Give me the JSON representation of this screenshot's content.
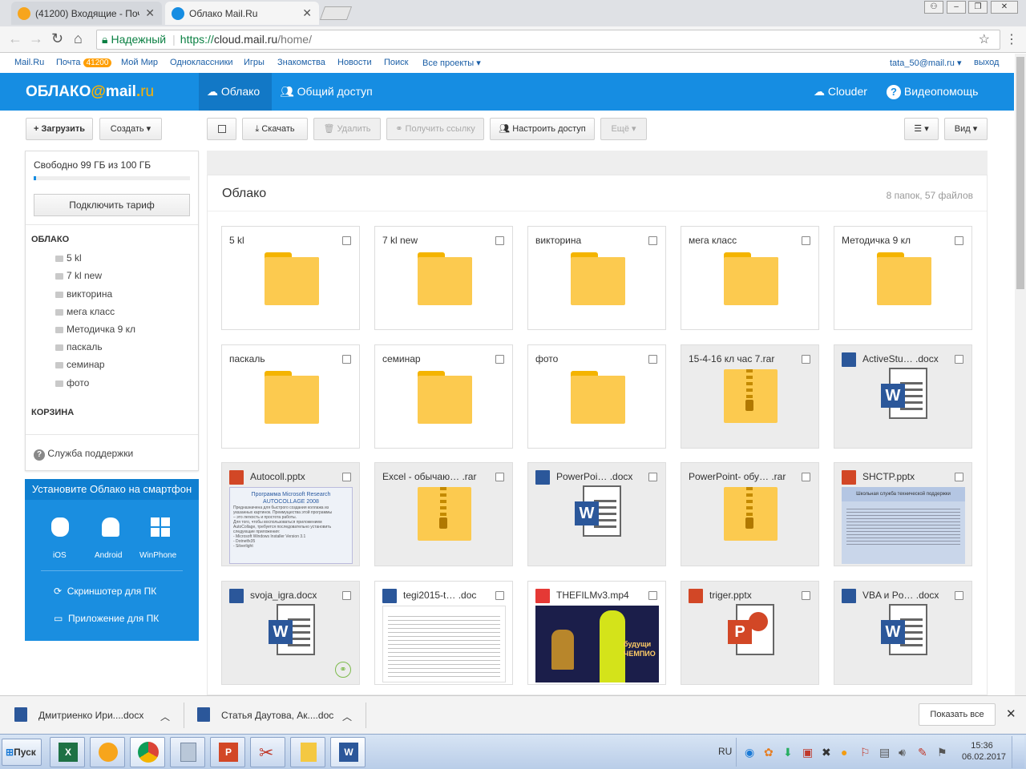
{
  "browser": {
    "tabs": [
      {
        "title": "(41200) Входящие - Почта"
      },
      {
        "title": "Облако Mail.Ru"
      }
    ],
    "url": {
      "secure_label": "Надежный",
      "scheme": "https://",
      "host": "cloud.mail.ru",
      "path": "/home/"
    }
  },
  "portal": {
    "links": [
      "Mail.Ru",
      "Почта",
      "Мой Мир",
      "Одноклассники",
      "Игры",
      "Знакомства",
      "Новости",
      "Поиск",
      "Все проекты"
    ],
    "mail_badge": "41200",
    "user": "tata_50@mail.ru",
    "logout": "выход"
  },
  "header": {
    "logo_main": "ОБЛАКО",
    "logo_at": "@",
    "logo_mail": "mail",
    "logo_dot": ".",
    "logo_ru": "ru",
    "nav_cloud": "Облако",
    "nav_shared": "Общий доступ",
    "clouder": "Clouder",
    "help": "Видеопомощь"
  },
  "toolbar": {
    "upload": "+ Загрузить",
    "create": "Создать",
    "download": "Скачать",
    "delete": "Удалить",
    "get_link": "Получить ссылку",
    "share": "Настроить доступ",
    "more": "Ещё",
    "view": "Вид"
  },
  "sidebar": {
    "quota": "Свободно 99 ГБ из 100 ГБ",
    "quota_used_fraction": 0.01,
    "tariff_button": "Подключить тариф",
    "section_cloud": "ОБЛАКО",
    "folders": [
      "5 kl",
      "7 kl new",
      "викторина",
      "мега класс",
      "Методичка 9 кл",
      "паскаль",
      "семинар",
      "фото"
    ],
    "section_trash": "КОРЗИНА",
    "support": "Служба поддержки"
  },
  "promo": {
    "title": "Установите Облако на смартфон",
    "platforms": [
      "iOS",
      "Android",
      "WinPhone"
    ],
    "screenshoter": "Скриншотер для ПК",
    "app_pc": "Приложение для ПК"
  },
  "main": {
    "title": "Облако",
    "counter": "8 папок, 57 файлов",
    "items": [
      {
        "name": "5 kl",
        "kind": "folder"
      },
      {
        "name": "7 kl new",
        "kind": "folder"
      },
      {
        "name": "викторина",
        "kind": "folder"
      },
      {
        "name": "мега класс",
        "kind": "folder"
      },
      {
        "name": "Методичка 9 кл",
        "kind": "folder"
      },
      {
        "name": "паскаль",
        "kind": "folder"
      },
      {
        "name": "семинар",
        "kind": "folder"
      },
      {
        "name": "фото",
        "kind": "folder"
      },
      {
        "name": "15-4-16 кл час 7.rar",
        "kind": "rar"
      },
      {
        "name": "ActiveStu… .docx",
        "kind": "docx"
      },
      {
        "name": "Autocoll.pptx",
        "kind": "pptx-preview"
      },
      {
        "name": "Excel - обычаю… .rar",
        "kind": "rar"
      },
      {
        "name": "PowerPoi… .docx",
        "kind": "docx"
      },
      {
        "name": "PowerPoint- обу… .rar",
        "kind": "rar"
      },
      {
        "name": "SHCTP.pptx",
        "kind": "pptx-preview2"
      },
      {
        "name": "svoja_igra.docx",
        "kind": "docx"
      },
      {
        "name": "tegi2015-t… .doc",
        "kind": "doc-preview"
      },
      {
        "name": "THEFILMv3.mp4",
        "kind": "video"
      },
      {
        "name": "triger.pptx",
        "kind": "pptx"
      },
      {
        "name": "VBA и Po… .docx",
        "kind": "docx"
      }
    ],
    "preview_autocoll": [
      "Программа Microsoft Research",
      "AUTOCOLLAGE 2008",
      "Предназначена для быстрого создания коллажа из",
      "указанных картинок. Преимущества этой программы",
      "– это легкость и простота работы.",
      "Для того, чтобы воспользоваться приложением",
      "AutoCollage, требуется последовательно установить",
      "следующие приложения:",
      "- Microsoft Windows Installer Version 3.1",
      "- Dotnetfx35",
      "- Silverlight"
    ],
    "preview_shctp": "Школьная служба технической поддержки",
    "video_caption": "будущи ЧЕМПИО"
  },
  "downloads": {
    "items": [
      "Дмитриенко Ири....docx",
      "Статья Даутова, Ак....doc"
    ],
    "show_all": "Показать все"
  },
  "taskbar": {
    "start": "Пуск",
    "lang": "RU",
    "time": "15:36",
    "date": "06.02.2017"
  },
  "colors": {
    "header_blue": "#168de2",
    "folder_yellow": "#fcca4f",
    "word_blue": "#2b579a",
    "ppt_red": "#d24726"
  }
}
